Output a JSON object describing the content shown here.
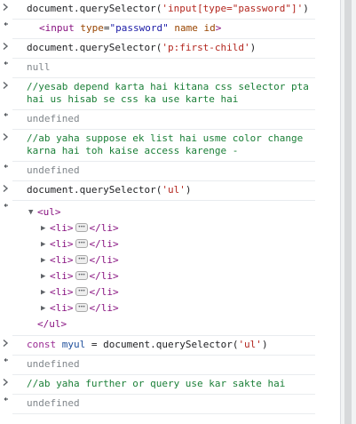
{
  "console": {
    "entries": [
      {
        "type": "input",
        "parts": [
          {
            "t": "document.querySelector(",
            "c": "plain"
          },
          {
            "t": "'input[type=\"password\"]'",
            "c": "str"
          },
          {
            "t": ")",
            "c": "plain"
          }
        ]
      },
      {
        "type": "element-result",
        "element": {
          "tag_open": "<input",
          "attr1_name": "type",
          "attr1_value": "\"password\"",
          "attr2_name": "name",
          "attr3_name": "id",
          "tag_close": ">"
        }
      },
      {
        "type": "input",
        "parts": [
          {
            "t": "document.querySelector(",
            "c": "plain"
          },
          {
            "t": "'p:first-child'",
            "c": "str"
          },
          {
            "t": ")",
            "c": "plain"
          }
        ]
      },
      {
        "type": "result",
        "text": "null"
      },
      {
        "type": "input",
        "parts": [
          {
            "t": "//yesab depend karta hai kitana css selector pta hai us hisab se css ka use karte hai",
            "c": "comment"
          }
        ]
      },
      {
        "type": "result",
        "text": "undefined"
      },
      {
        "type": "input",
        "parts": [
          {
            "t": "//ab yaha suppose ek list hai usme color change karna hai toh kaise access karenge -",
            "c": "comment"
          }
        ]
      },
      {
        "type": "result",
        "text": "undefined"
      },
      {
        "type": "input",
        "parts": [
          {
            "t": "document.querySelector(",
            "c": "plain"
          },
          {
            "t": "'ul'",
            "c": "str"
          },
          {
            "t": ")",
            "c": "plain"
          }
        ]
      },
      {
        "type": "tree-result",
        "root_open": "<ul>",
        "root_close": "</ul>",
        "child_open": "<li>",
        "child_close": "</li>",
        "child_count": 6
      },
      {
        "type": "input",
        "parts": [
          {
            "t": "const",
            "c": "kw"
          },
          {
            "t": " ",
            "c": "plain"
          },
          {
            "t": "myul",
            "c": "var"
          },
          {
            "t": " = document.querySelector(",
            "c": "plain"
          },
          {
            "t": "'ul'",
            "c": "str"
          },
          {
            "t": ")",
            "c": "plain"
          }
        ]
      },
      {
        "type": "result",
        "text": "undefined"
      },
      {
        "type": "input",
        "parts": [
          {
            "t": "//ab yaha further or query use kar sakte hai",
            "c": "comment"
          }
        ]
      },
      {
        "type": "result",
        "text": "undefined"
      }
    ]
  },
  "icons": {
    "input_prompt": "chevron-right-icon",
    "result_marker": "return-arrow-icon",
    "expanded": "triangle-down-icon",
    "collapsed": "triangle-right-icon",
    "ellipsis": "ellipsis-icon"
  },
  "colors": {
    "string": "#b3261e",
    "keyword": "#9b2c94",
    "variable": "#1f4f9b",
    "comment": "#1a7f37",
    "result": "#80868b",
    "tag": "#881280",
    "attr_name": "#994500",
    "attr_value": "#1a1aa6"
  }
}
